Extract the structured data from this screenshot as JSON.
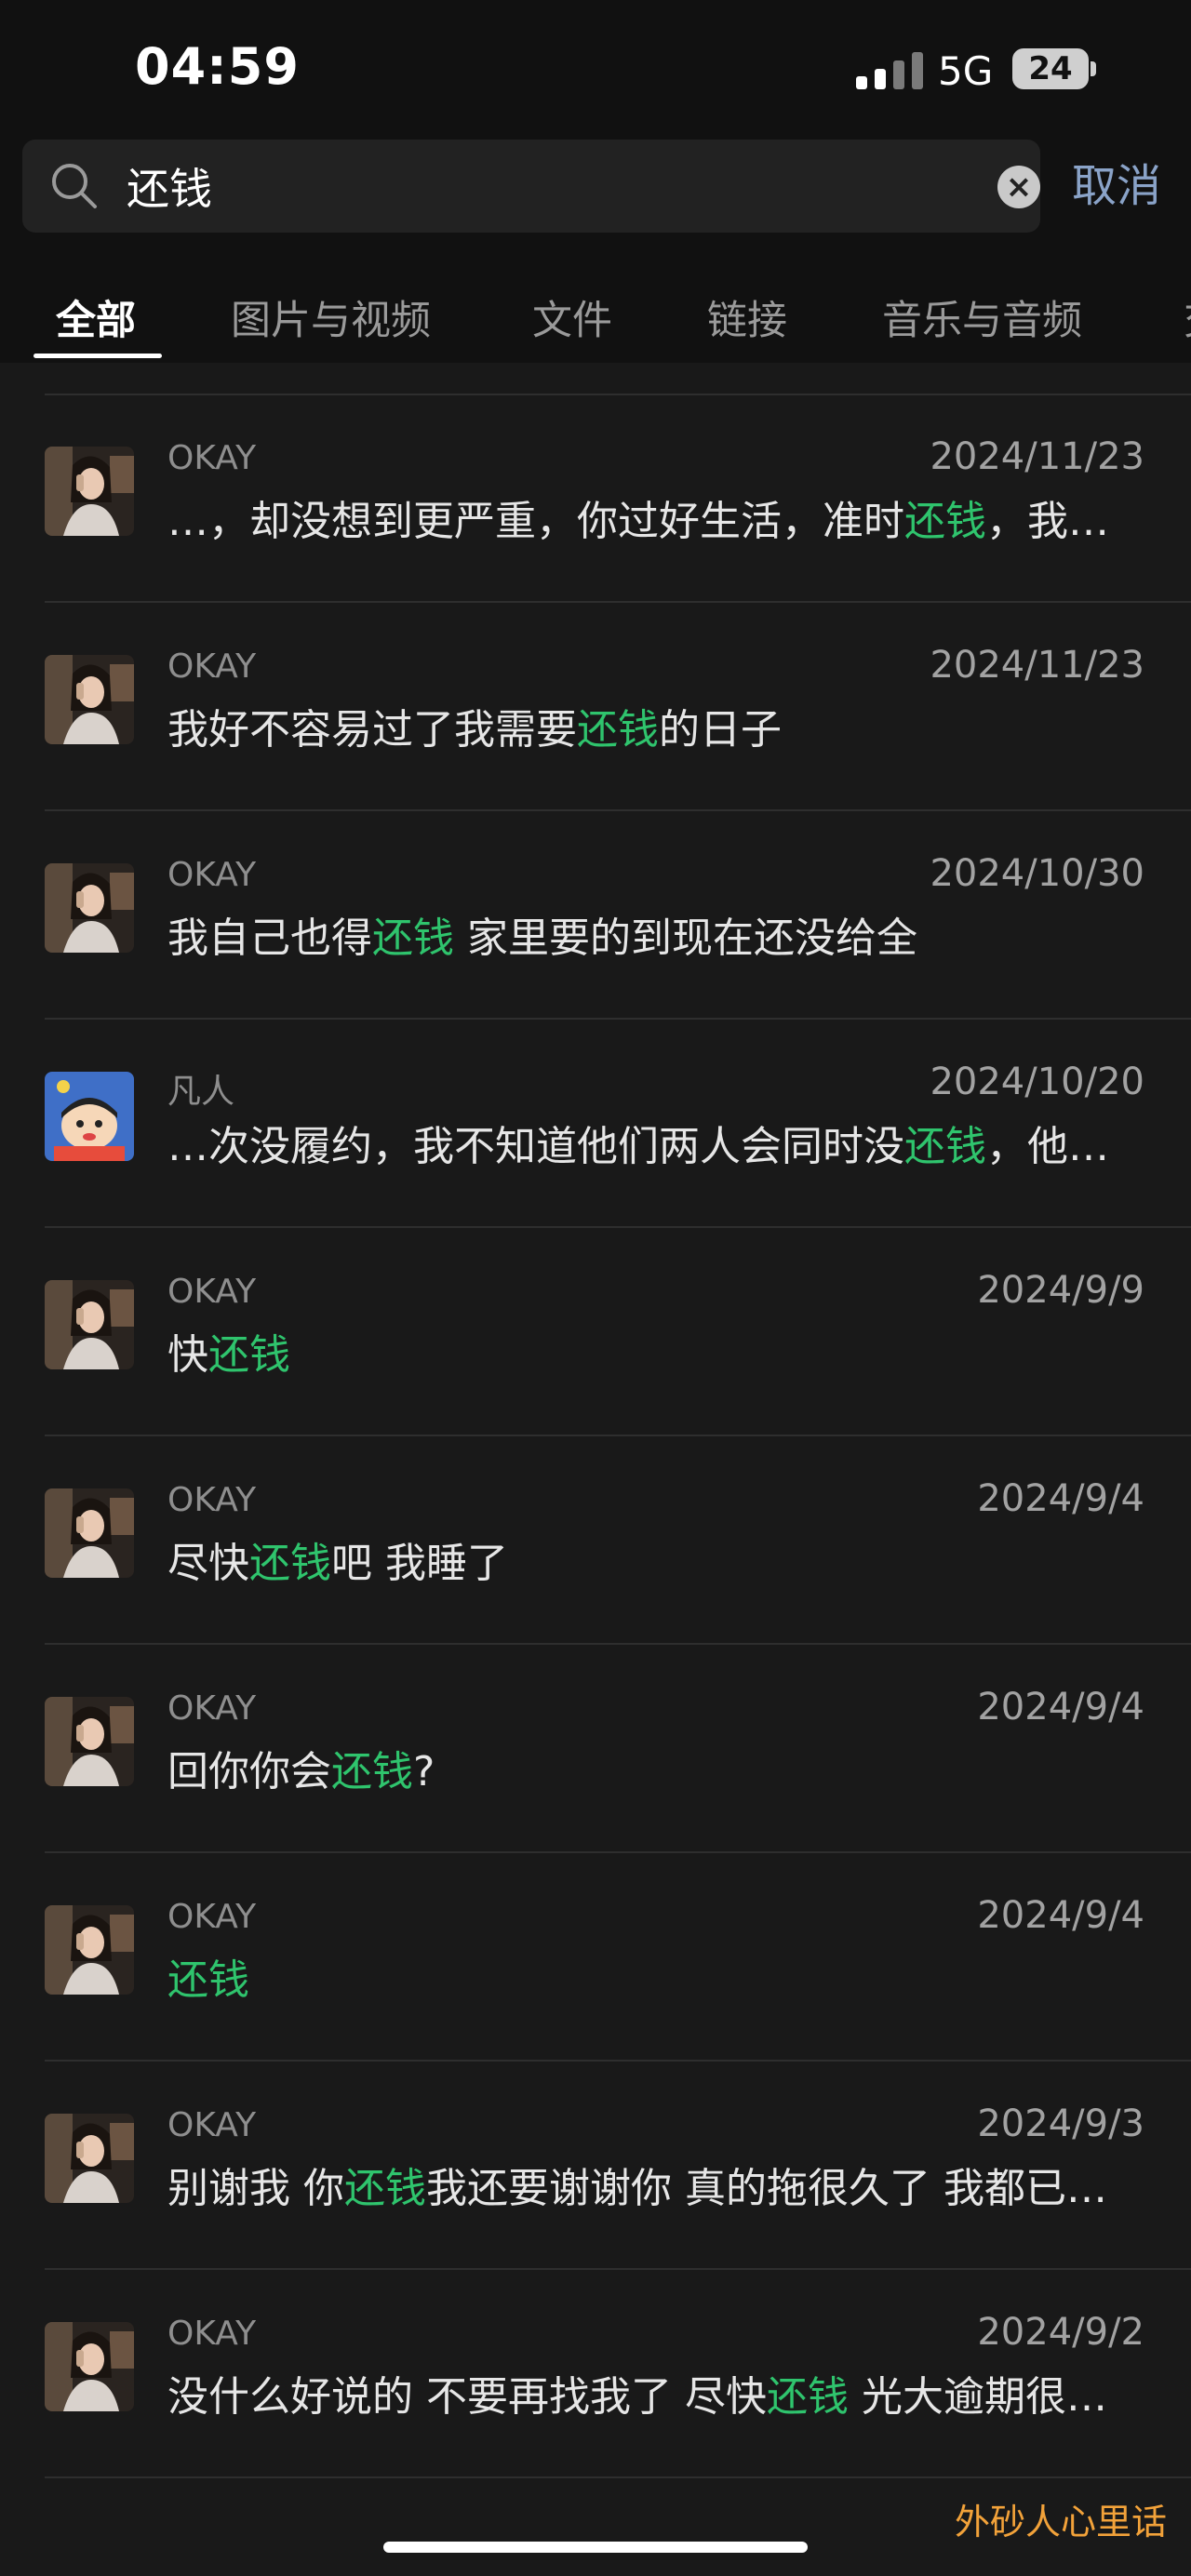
{
  "status_bar": {
    "time": "04:59",
    "network": "5G",
    "battery": "24"
  },
  "search": {
    "query": "还钱",
    "placeholder": "",
    "cancel_label": "取消"
  },
  "tabs": [
    {
      "label": "全部",
      "active": true
    },
    {
      "label": "图片与视频",
      "active": false
    },
    {
      "label": "文件",
      "active": false
    },
    {
      "label": "链接",
      "active": false
    },
    {
      "label": "音乐与音频",
      "active": false
    },
    {
      "label": "交",
      "active": false
    }
  ],
  "results": [
    {
      "sender": "OKAY",
      "date": "2024/11/23",
      "avatar": "okay-avatar",
      "parts": [
        {
          "text": "…，却没想到更严重，你过好生活，准时"
        },
        {
          "text": "还钱",
          "hl": true
        },
        {
          "text": "，我…"
        }
      ]
    },
    {
      "sender": "OKAY",
      "date": "2024/11/23",
      "avatar": "okay-avatar",
      "parts": [
        {
          "text": "我好不容易过了我需要"
        },
        {
          "text": "还钱",
          "hl": true
        },
        {
          "text": "的日子"
        }
      ]
    },
    {
      "sender": "OKAY",
      "date": "2024/10/30",
      "avatar": "okay-avatar",
      "parts": [
        {
          "text": "我自己也得"
        },
        {
          "text": "还钱",
          "hl": true
        },
        {
          "text": " 家里要的到现在还没给全"
        }
      ]
    },
    {
      "sender": "凡人",
      "date": "2024/10/20",
      "avatar": "cartoon-avatar",
      "parts": [
        {
          "text": "…次没履约，我不知道他们两人会同时没"
        },
        {
          "text": "还钱",
          "hl": true
        },
        {
          "text": "，他…"
        }
      ]
    },
    {
      "sender": "OKAY",
      "date": "2024/9/9",
      "avatar": "okay-avatar",
      "parts": [
        {
          "text": "快"
        },
        {
          "text": "还钱",
          "hl": true
        }
      ]
    },
    {
      "sender": "OKAY",
      "date": "2024/9/4",
      "avatar": "okay-avatar",
      "parts": [
        {
          "text": "尽快"
        },
        {
          "text": "还钱",
          "hl": true
        },
        {
          "text": "吧 我睡了"
        }
      ]
    },
    {
      "sender": "OKAY",
      "date": "2024/9/4",
      "avatar": "okay-avatar",
      "parts": [
        {
          "text": "回你你会"
        },
        {
          "text": "还钱",
          "hl": true
        },
        {
          "text": "?"
        }
      ]
    },
    {
      "sender": "OKAY",
      "date": "2024/9/4",
      "avatar": "okay-avatar",
      "parts": [
        {
          "text": "还钱",
          "hl": true
        }
      ]
    },
    {
      "sender": "OKAY",
      "date": "2024/9/3",
      "avatar": "okay-avatar",
      "parts": [
        {
          "text": "别谢我 你"
        },
        {
          "text": "还钱",
          "hl": true
        },
        {
          "text": "我还要谢谢你 真的拖很久了 我都已…"
        }
      ]
    },
    {
      "sender": "OKAY",
      "date": "2024/9/2",
      "avatar": "okay-avatar",
      "parts": [
        {
          "text": "没什么好说的 不要再找我了 尽快"
        },
        {
          "text": "还钱",
          "hl": true
        },
        {
          "text": " 光大逾期很…"
        }
      ]
    }
  ],
  "watermark": "外砂人心里话",
  "colors": {
    "highlight": "#2fc46d",
    "cancel": "#8aa3c8",
    "watermark": "#f2a23a",
    "background": "#191919"
  }
}
